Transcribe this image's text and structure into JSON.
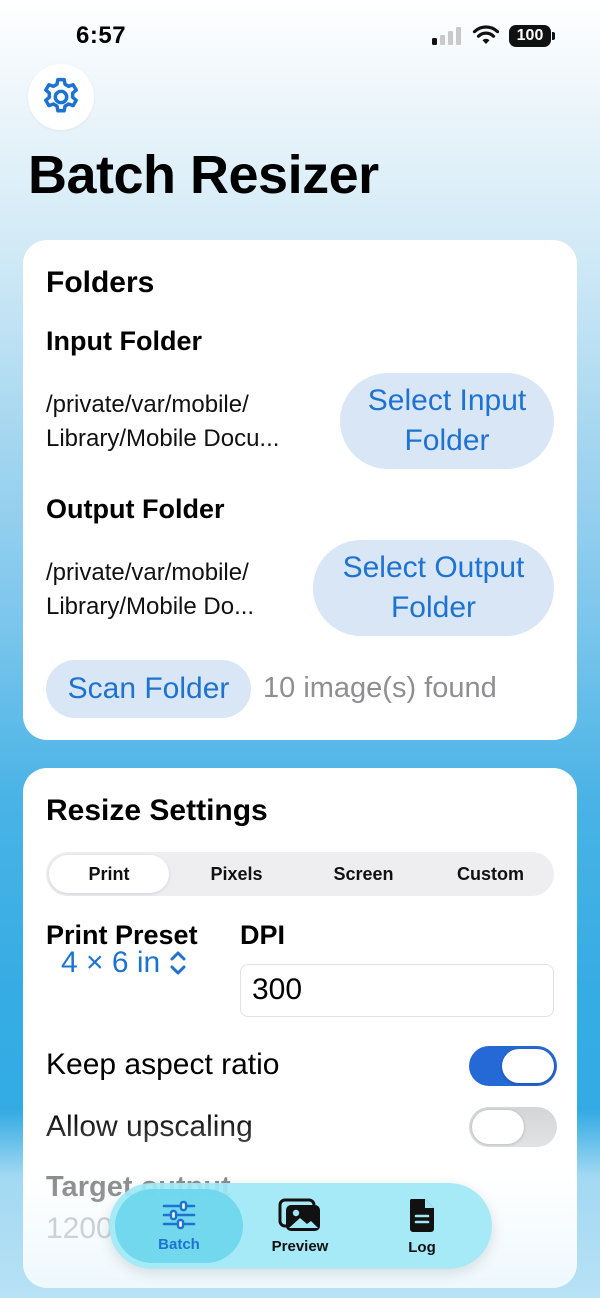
{
  "status_bar": {
    "time": "6:57",
    "battery": "100"
  },
  "header": {
    "title": "Batch Resizer",
    "settings_icon": "gear-icon"
  },
  "folders": {
    "title": "Folders",
    "input_label": "Input Folder",
    "input_path_line1": "/private/var/mobile/",
    "input_path_line2": "Library/Mobile Docu...",
    "select_input_line1": "Select Input",
    "select_input_line2": "Folder",
    "output_label": "Output Folder",
    "output_path_line1": "/private/var/mobile/",
    "output_path_line2": "Library/Mobile Do...",
    "select_output_line1": "Select Output",
    "select_output_line2": "Folder",
    "scan_button": "Scan Folder",
    "found_text": "10 image(s) found"
  },
  "resize": {
    "title": "Resize Settings",
    "segments": [
      "Print",
      "Pixels",
      "Screen",
      "Custom"
    ],
    "selected_segment": "Print",
    "preset_label": "Print Preset",
    "preset_value": "4 × 6 in",
    "dpi_label": "DPI",
    "dpi_value": "300",
    "keep_aspect_label": "Keep aspect ratio",
    "keep_aspect_on": true,
    "allow_upscaling_label": "Allow upscaling",
    "allow_upscaling_on": false,
    "target_output_label": "Target output",
    "target_output_value": "1200"
  },
  "colors": {
    "accent": "#1e72d0",
    "toggle_on": "#2469d6",
    "pill_bg": "#d8e6f6"
  },
  "tab_bar": {
    "tabs": [
      {
        "label": "Batch",
        "icon": "sliders-icon",
        "selected": true
      },
      {
        "label": "Preview",
        "icon": "photos-icon",
        "selected": false
      },
      {
        "label": "Log",
        "icon": "document-icon",
        "selected": false
      }
    ]
  }
}
